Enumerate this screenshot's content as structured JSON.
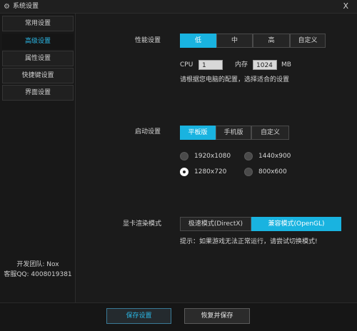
{
  "window": {
    "title": "系统设置",
    "close_glyph": "X",
    "icon": "gear-icon"
  },
  "sidebar": {
    "items": [
      {
        "label": "常用设置",
        "active": false
      },
      {
        "label": "高级设置",
        "active": true
      },
      {
        "label": "属性设置",
        "active": false
      },
      {
        "label": "快捷键设置",
        "active": false
      },
      {
        "label": "界面设置",
        "active": false
      }
    ],
    "team": "开发团队: Nox",
    "qq": "客服QQ: 4008019381"
  },
  "performance": {
    "label": "性能设置",
    "options": [
      "低",
      "中",
      "高",
      "自定义"
    ],
    "selected": "低",
    "cpu_label": "CPU",
    "cpu_value": "1",
    "mem_label": "内存",
    "mem_value": "1024",
    "mem_unit": "MB",
    "hint": "请根据您电脑的配置，选择适合的设置"
  },
  "startup": {
    "label": "启动设置",
    "options": [
      "平板版",
      "手机版",
      "自定义"
    ],
    "selected": "平板版",
    "resolutions": [
      "1920x1080",
      "1440x900",
      "1280x720",
      "800x600"
    ],
    "selected_resolution": "1280x720"
  },
  "render": {
    "label": "显卡渲染模式",
    "options": [
      "极速模式(DirectX)",
      "兼容模式(OpenGL)"
    ],
    "selected": "兼容模式(OpenGL)",
    "hint": "提示：如果游戏无法正常运行，请尝试切换模式!"
  },
  "footer": {
    "save_label": "保存设置",
    "restore_label": "恢复并保存"
  },
  "colors": {
    "accent": "#19b3e0",
    "background": "#1b1b1b",
    "sidebar_active_text": "#2bb8e6"
  }
}
